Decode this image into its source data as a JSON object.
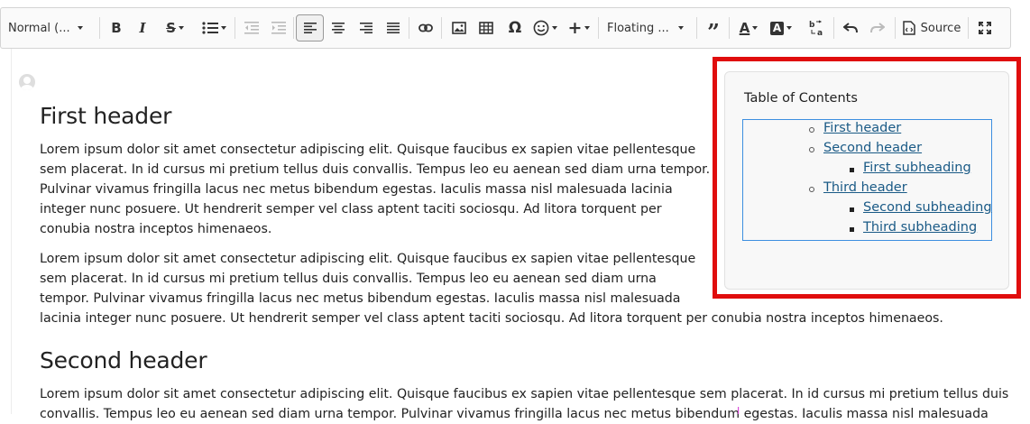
{
  "toolbar": {
    "format_label": "Normal (...",
    "floating_label": "Floating ...",
    "source_label": "Source",
    "icons": [
      "bold-icon",
      "italic-icon",
      "strikethrough-icon",
      "list-icon",
      "outdent-icon",
      "indent-icon",
      "align-left-icon",
      "align-center-icon",
      "align-right-icon",
      "justify-icon",
      "link-icon",
      "image-icon",
      "table-icon",
      "omega-icon",
      "emoji-icon",
      "plus-icon",
      "quote-icon",
      "text-color-icon",
      "background-color-icon",
      "translate-icon",
      "undo-icon",
      "redo-icon",
      "source-icon",
      "fullscreen-icon"
    ]
  },
  "document": {
    "heading_1": "First header",
    "paragraph_1": "Lorem ipsum dolor sit amet consectetur adipiscing elit. Quisque faucibus ex sapien vitae pellentesque sem placerat. In id cursus mi pretium tellus duis convallis. Tempus leo eu aenean sed diam urna tempor. Pulvinar vivamus fringilla lacus nec metus bibendum egestas. Iaculis massa nisl malesuada lacinia integer nunc posuere. Ut hendrerit semper vel class aptent taciti sociosqu. Ad litora torquent per conubia nostra inceptos himenaeos.",
    "paragraph_2_lines": [
      "Lorem ipsum dolor sit amet consectetur adipiscing elit. Quisque faucibus ex sapien vitae pellentesque",
      "sem placerat. In id cursus mi pretium tellus duis convallis. Tempus leo eu aenean sed diam urna",
      "tempor. Pulvinar vivamus fringilla lacus nec metus bibendum egestas. Iaculis massa nisl malesuada",
      "lacinia integer nunc posuere. Ut hendrerit semper vel class aptent taciti sociosqu. Ad litora torquent per conubia nostra inceptos himenaeos."
    ],
    "heading_2": "Second header",
    "paragraph_3_lines": [
      "Lorem ipsum dolor sit amet consectetur adipiscing elit. Quisque faucibus ex sapien vitae pellentesque sem placerat. In id cursus mi pretium tellus duis",
      "convallis. Tempus leo eu aenean sed diam urna tempor. Pulvinar vivamus fringilla lacus nec metus bibendum egestas. Iaculis massa nisl malesuada"
    ]
  },
  "toc": {
    "title": "Table of Contents",
    "items": [
      {
        "label": "First header",
        "level": 1
      },
      {
        "label": "Second header",
        "level": 1
      },
      {
        "label": "First subheading",
        "level": 2
      },
      {
        "label": "Third header",
        "level": 1
      },
      {
        "label": "Second subheading",
        "level": 2
      },
      {
        "label": "Third subheading",
        "level": 2
      }
    ]
  },
  "colors": {
    "highlight_frame": "#e00d0d",
    "toc_link": "#1a5a86",
    "selection_border": "#3d8fe0"
  }
}
